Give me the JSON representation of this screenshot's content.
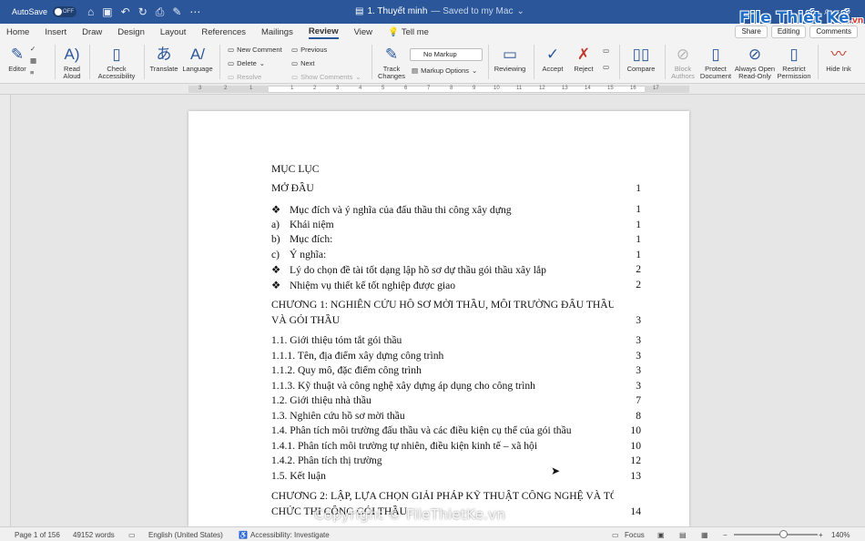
{
  "titlebar": {
    "autosave_label": "AutoSave",
    "autosave_state": "OFF",
    "doc_name": "1. Thuyết minh",
    "saved_status": "— Saved to my Mac"
  },
  "tabs": [
    "Home",
    "Insert",
    "Draw",
    "Design",
    "Layout",
    "References",
    "Mailings",
    "Review",
    "View"
  ],
  "tell_me": "Tell me",
  "share": {
    "share": "Share",
    "editing": "Editing",
    "comments": "Comments"
  },
  "ribbon": {
    "editor": "Editor",
    "read_aloud": [
      "Read",
      "Aloud"
    ],
    "check_accessibility": [
      "Check",
      "Accessibility"
    ],
    "translate": "Translate",
    "language": "Language",
    "new_comment": "New Comment",
    "delete": "Delete",
    "resolve": "Resolve",
    "previous": "Previous",
    "next": "Next",
    "show_comments": "Show Comments",
    "track_changes": [
      "Track",
      "Changes"
    ],
    "markup_select": "No Markup",
    "markup_options": "Markup Options",
    "reviewing": "Reviewing",
    "accept": "Accept",
    "reject": "Reject",
    "compare": "Compare",
    "block_authors": [
      "Block",
      "Authors"
    ],
    "protect_document": [
      "Protect",
      "Document"
    ],
    "always_open_read_only": [
      "Always Open",
      "Read-Only"
    ],
    "restrict_permission": [
      "Restrict",
      "Permission"
    ],
    "hide_ink": "Hide Ink"
  },
  "ruler_ticks": [
    "3",
    "2",
    "1",
    "1",
    "2",
    "3",
    "4",
    "5",
    "6",
    "7",
    "8",
    "9",
    "10",
    "11",
    "12",
    "13",
    "14",
    "15",
    "16",
    "17"
  ],
  "document": {
    "toc_heading": "MỤC LỤC",
    "entries": [
      {
        "text": "MỞ ĐẦU",
        "page": "1",
        "marker": ""
      },
      {
        "text": "Mục đích và ý nghĩa của đấu thầu thi công xây dựng",
        "page": "1",
        "marker": "❖"
      },
      {
        "text": "Khái niệm",
        "page": "1",
        "marker": "a)"
      },
      {
        "text": "Mục đích:",
        "page": "1",
        "marker": "b)"
      },
      {
        "text": "Ý nghĩa:",
        "page": "1",
        "marker": "c)"
      },
      {
        "text": "Lý do chọn đề tài tốt dạng lập hồ sơ dự thầu gói thầu xây lắp",
        "page": "2",
        "marker": "❖"
      },
      {
        "text": "Nhiệm vụ thiết kế tốt nghiệp được giao",
        "page": "2",
        "marker": "❖"
      },
      {
        "text": "CHƯƠNG 1: NGHIÊN CỨU HỒ SƠ MỜI THẦU, MÔI TRƯỜNG ĐẤU THẦU",
        "page": "",
        "marker": ""
      },
      {
        "text": "VÀ GÓI THẦU",
        "page": "3",
        "marker": ""
      },
      {
        "text": "1.1. Giới thiệu tóm tắt gói thầu",
        "page": "3",
        "marker": ""
      },
      {
        "text": "1.1.1. Tên, địa điểm xây dựng công trình",
        "page": "3",
        "marker": ""
      },
      {
        "text": "1.1.2. Quy mô, đặc điểm công trình",
        "page": "3",
        "marker": ""
      },
      {
        "text": "1.1.3. Kỹ thuật và công nghệ xây dựng áp dụng cho công trình",
        "page": "3",
        "marker": ""
      },
      {
        "text": "1.2. Giới thiệu nhà thầu",
        "page": "7",
        "marker": ""
      },
      {
        "text": "1.3. Nghiên cứu hồ sơ mời thầu",
        "page": "8",
        "marker": ""
      },
      {
        "text": "1.4. Phân tích môi trường đấu thầu và các điều kiện cụ thể của gói thầu",
        "page": "10",
        "marker": ""
      },
      {
        "text": "1.4.1. Phân tích môi trường tự nhiên, điều kiện kinh tế – xã hội",
        "page": "10",
        "marker": ""
      },
      {
        "text": "1.4.2. Phân tích thị trường",
        "page": "12",
        "marker": ""
      },
      {
        "text": "1.5. Kết luận",
        "page": "13",
        "marker": ""
      },
      {
        "text": "CHƯƠNG 2: LẬP, LỰA CHỌN GIẢI PHÁP KỸ THUẬT CÔNG NGHỆ VÀ TỔ",
        "page": "",
        "marker": ""
      },
      {
        "text": "CHỨC THI CÔNG GÓI THẦU",
        "page": "14",
        "marker": ""
      }
    ]
  },
  "watermark": "Copyright © FileThietKe.vn",
  "logo": {
    "main": "File Thiết Kế",
    "suffix": ".vn"
  },
  "status": {
    "page": "Page 1 of 156",
    "words": "49152 words",
    "language": "English (United States)",
    "accessibility": "Accessibility: Investigate",
    "focus": "Focus",
    "zoom": "140%",
    "zoom_level_percent": 140
  }
}
